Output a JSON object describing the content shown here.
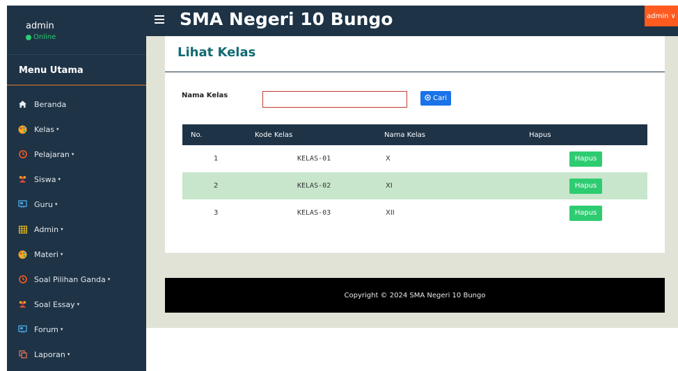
{
  "sidebar": {
    "user": {
      "name": "admin",
      "status": "Online"
    },
    "menu_title": "Menu Utama",
    "items": [
      {
        "label": "Beranda",
        "icon": "home-icon",
        "has_caret": false
      },
      {
        "label": "Kelas",
        "icon": "palette-icon",
        "has_caret": true
      },
      {
        "label": "Pelajaran",
        "icon": "clock-icon",
        "has_caret": true
      },
      {
        "label": "Siswa",
        "icon": "users-icon",
        "has_caret": true
      },
      {
        "label": "Guru",
        "icon": "presentation-icon",
        "has_caret": true
      },
      {
        "label": "Admin",
        "icon": "table-icon",
        "has_caret": true
      },
      {
        "label": "Materi",
        "icon": "palette-icon",
        "has_caret": true
      },
      {
        "label": "Soal Pilihan Ganda",
        "icon": "clock-icon",
        "has_caret": true
      },
      {
        "label": "Soal Essay",
        "icon": "users-icon",
        "has_caret": true
      },
      {
        "label": "Forum",
        "icon": "presentation-icon",
        "has_caret": true
      },
      {
        "label": "Laporan",
        "icon": "copy-icon",
        "has_caret": true
      }
    ],
    "caret": "▾"
  },
  "header": {
    "site_title": "SMA Negeri 10 Bungo",
    "user_menu": "admin",
    "user_menu_caret": "∨"
  },
  "page": {
    "title": "Lihat Kelas",
    "form": {
      "label": "Nama Kelas",
      "input_value": "",
      "search_button": "Cari"
    },
    "table": {
      "headers": [
        "No.",
        "Kode Kelas",
        "Nama Kelas",
        "Hapus"
      ],
      "rows": [
        {
          "no": "1",
          "kode": "KELAS-01",
          "nama": "X",
          "action": "Hapus"
        },
        {
          "no": "2",
          "kode": "KELAS-02",
          "nama": "XI",
          "action": "Hapus"
        },
        {
          "no": "3",
          "kode": "KELAS-03",
          "nama": "XII",
          "action": "Hapus"
        }
      ]
    }
  },
  "footer": {
    "text": "Copyright © 2024 SMA Negeri 10 Bungo"
  },
  "colors": {
    "sidebar_bg": "#1e3346",
    "accent_orange": "#ff5a1f",
    "title_teal": "#136a72",
    "button_blue": "#1a73e8",
    "button_green": "#2ecc71",
    "row_highlight": "#c8e6cc"
  }
}
